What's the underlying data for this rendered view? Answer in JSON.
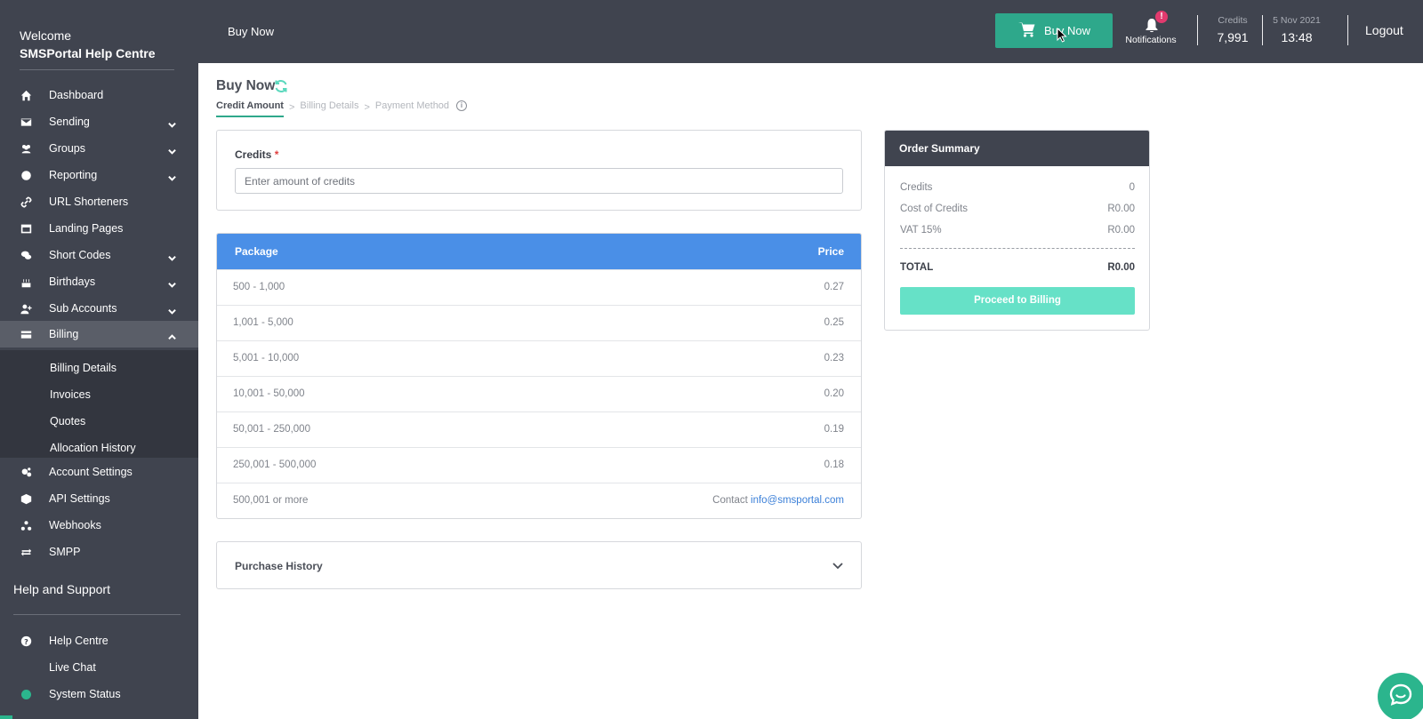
{
  "sidebar": {
    "welcome": "Welcome",
    "account_name": "SMSPortal Help Centre",
    "items": [
      {
        "label": "Dashboard",
        "icon": "home-icon"
      },
      {
        "label": "Sending",
        "icon": "envelope-icon"
      },
      {
        "label": "Groups",
        "icon": "users-icon"
      },
      {
        "label": "Reporting",
        "icon": "chart-pie-icon"
      },
      {
        "label": "URL Shorteners",
        "icon": "link-icon"
      },
      {
        "label": "Landing Pages",
        "icon": "window-icon"
      },
      {
        "label": "Short Codes",
        "icon": "comments-icon"
      },
      {
        "label": "Birthdays",
        "icon": "cake-icon"
      },
      {
        "label": "Sub Accounts",
        "icon": "user-plus-icon"
      },
      {
        "label": "Billing",
        "icon": "credit-card-icon"
      },
      {
        "label": "Account Settings",
        "icon": "cogs-icon"
      },
      {
        "label": "API Settings",
        "icon": "cube-icon"
      },
      {
        "label": "Webhooks",
        "icon": "webhook-icon"
      },
      {
        "label": "SMPP",
        "icon": "exchange-icon"
      }
    ],
    "billing_submenu": [
      "Billing Details",
      "Invoices",
      "Quotes",
      "Allocation History"
    ],
    "help_title": "Help and Support",
    "help_items": [
      {
        "label": "Help Centre",
        "icon": "question-circle-icon"
      },
      {
        "label": "Live Chat",
        "icon": ""
      },
      {
        "label": "System Status",
        "icon": "status-dot-icon"
      }
    ]
  },
  "topbar": {
    "title": "Buy Now",
    "buy_button": "Buy Now",
    "notifications_label": "Notifications",
    "notifications_badge": "!",
    "credits_label": "Credits",
    "credits_value": "7,991",
    "date": "5 Nov 2021",
    "time": "13:48",
    "logout": "Logout"
  },
  "main": {
    "title": "Buy Now",
    "breadcrumb": {
      "step1": "Credit Amount",
      "sep": ">",
      "step2": "Billing Details",
      "step3": "Payment Method"
    },
    "credits_form": {
      "label": "Credits",
      "required_mark": "*",
      "placeholder": "Enter amount of credits"
    },
    "package_table": {
      "headers": {
        "package": "Package",
        "price": "Price"
      },
      "rows": [
        {
          "package": "500 - 1,000",
          "price": "0.27"
        },
        {
          "package": "1,001 - 5,000",
          "price": "0.25"
        },
        {
          "package": "5,001 - 10,000",
          "price": "0.23"
        },
        {
          "package": "10,001 - 50,000",
          "price": "0.20"
        },
        {
          "package": "50,001 - 250,000",
          "price": "0.19"
        },
        {
          "package": "250,001 - 500,000",
          "price": "0.18"
        }
      ],
      "last_row": {
        "package": "500,001 or more",
        "contact_text": "Contact",
        "email": "info@smsportal.com"
      }
    },
    "purchase_history": "Purchase History"
  },
  "order_summary": {
    "title": "Order Summary",
    "credits_label": "Credits",
    "credits_value": "0",
    "cost_label": "Cost of Credits",
    "cost_value": "R0.00",
    "vat_label": "VAT 15%",
    "vat_value": "R0.00",
    "total_label": "TOTAL",
    "total_value": "R0.00",
    "proceed_button": "Proceed to Billing"
  },
  "colors": {
    "sidebar_bg": "#40444f",
    "accent_green": "#2ea88b",
    "table_header_blue": "#4a8fe7",
    "proceed_button": "#66e1c7",
    "badge_pink": "#e23a6e"
  }
}
